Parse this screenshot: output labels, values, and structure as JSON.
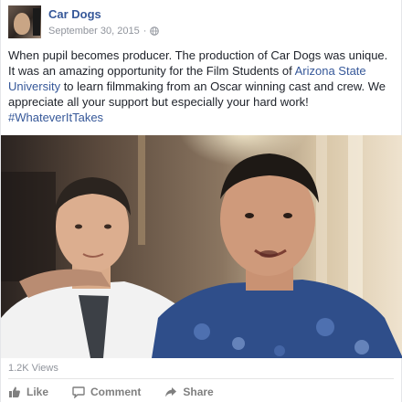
{
  "post": {
    "page_name": "Car Dogs",
    "date": "September 30, 2015",
    "separator": "·",
    "privacy_icon": "globe-icon",
    "text_part1": "When pupil becomes producer. The production of Car Dogs was unique. It was an amazing opportunity for the Film Students of ",
    "link_text": "Arizona State University",
    "text_part2": " to learn filmmaking from an Oscar winning cast and crew. We appreciate all your support but especially your hard work!",
    "hashtag": "#WhateverItTakes"
  },
  "video": {
    "views": "1.2K Views"
  },
  "actions": {
    "like_label": "Like",
    "like_icon": "thumbs-up-icon",
    "comment_label": "Comment",
    "comment_icon": "speech-bubble-icon",
    "share_label": "Share",
    "share_icon": "share-arrow-icon"
  },
  "colors": {
    "link": "#365899",
    "text": "#1d2129",
    "meta": "#90949c",
    "action": "#7f7f7f"
  }
}
